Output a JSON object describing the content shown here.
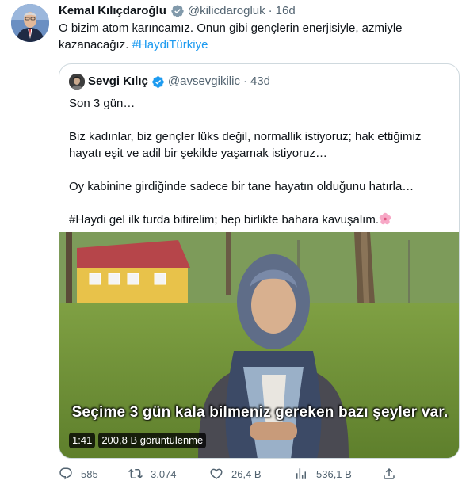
{
  "tweet": {
    "author_name": "Kemal Kılıçdaroğlu",
    "handle": "@kilicdarogluk",
    "dot": "·",
    "time": "16d",
    "text_main": "O bizim atom karıncamız. Onun gibi gençlerin enerjisiyle, azmiyle kazanacağız. ",
    "hashtag": "#HaydiTürkiye"
  },
  "quote": {
    "author_name": "Sevgi Kılıç",
    "handle": "@avsevgikilic",
    "dot": "·",
    "time": "43d",
    "lines": [
      "Son 3 gün…",
      "Biz kadınlar, biz gençler lüks değil, normallik istiyoruz; hak ettiğimiz hayatı eşit ve adil bir şekilde yaşamak istiyoruz…",
      "Oy kabinine girdiğinde sadece bir tane hayatın olduğunu hatırla…",
      "#Haydi gel ilk turda bitirelim; hep birlikte bahara kavuşalım."
    ],
    "media": {
      "subtitle": "Seçime 3 gün kala bilmeniz gereken bazı şeyler var.",
      "duration": "1:41",
      "views": "200,8 B görüntülenme"
    }
  },
  "actions": {
    "replies": "585",
    "retweets": "3.074",
    "likes": "26,4 B",
    "views": "536,1 B"
  },
  "colors": {
    "accent": "#1d9bf0",
    "secondary_text": "#536471",
    "border": "#cfd9de"
  }
}
